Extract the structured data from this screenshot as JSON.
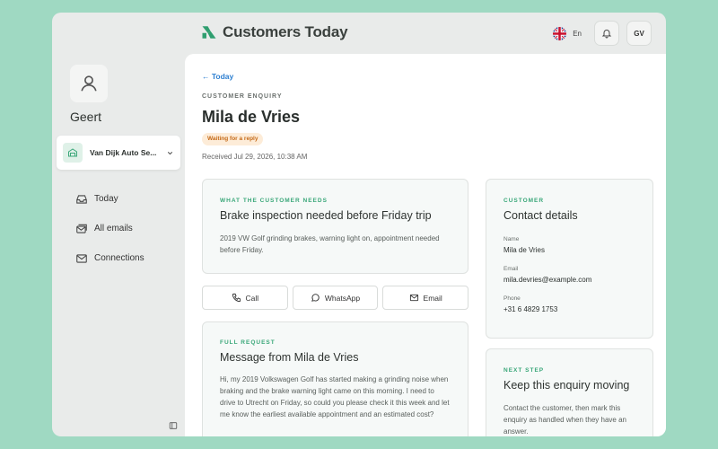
{
  "app": {
    "title": "Customers Today"
  },
  "topbar": {
    "language": "En",
    "initials": "GV"
  },
  "sidebar": {
    "user_name": "Geert",
    "company": "Van Dijk Auto Se...",
    "items": [
      {
        "label": "Today",
        "icon": "inbox-icon"
      },
      {
        "label": "All emails",
        "icon": "mail-stack-icon"
      },
      {
        "label": "Connections",
        "icon": "envelope-icon"
      }
    ]
  },
  "page": {
    "back_label": "← Today",
    "eyebrow": "CUSTOMER ENQUIRY",
    "title": "Mila de Vries",
    "status": "Waiting for a reply",
    "received": "Received Jul 29, 2026, 10:38 AM"
  },
  "needs": {
    "eyebrow": "WHAT THE CUSTOMER NEEDS",
    "title": "Brake inspection needed before Friday trip",
    "body": "2019 VW Golf grinding brakes, warning light on, appointment needed before Friday."
  },
  "actions": {
    "call": "Call",
    "whatsapp": "WhatsApp",
    "email": "Email"
  },
  "request": {
    "eyebrow": "FULL REQUEST",
    "title": "Message from Mila de Vries",
    "body": "Hi, my 2019 Volkswagen Golf has started making a grinding noise when braking and the brake warning light came on this morning. I need to drive to Utrecht on Friday, so could you please check it this week and let me know the earliest available appointment and an estimated cost?"
  },
  "contact": {
    "eyebrow": "CUSTOMER",
    "title": "Contact details",
    "name_label": "Name",
    "name": "Mila de Vries",
    "email_label": "Email",
    "email": "mila.devries@example.com",
    "phone_label": "Phone",
    "phone": "+31 6 4829 1753"
  },
  "next_step": {
    "eyebrow": "NEXT STEP",
    "title": "Keep this enquiry moving",
    "body": "Contact the customer, then mark this enquiry as handled when they have an answer."
  },
  "colors": {
    "background": "#9fd9c2",
    "accent": "#3aa779",
    "link": "#2f80d1",
    "badge_bg": "#fdecd8",
    "badge_text": "#c56a18"
  }
}
